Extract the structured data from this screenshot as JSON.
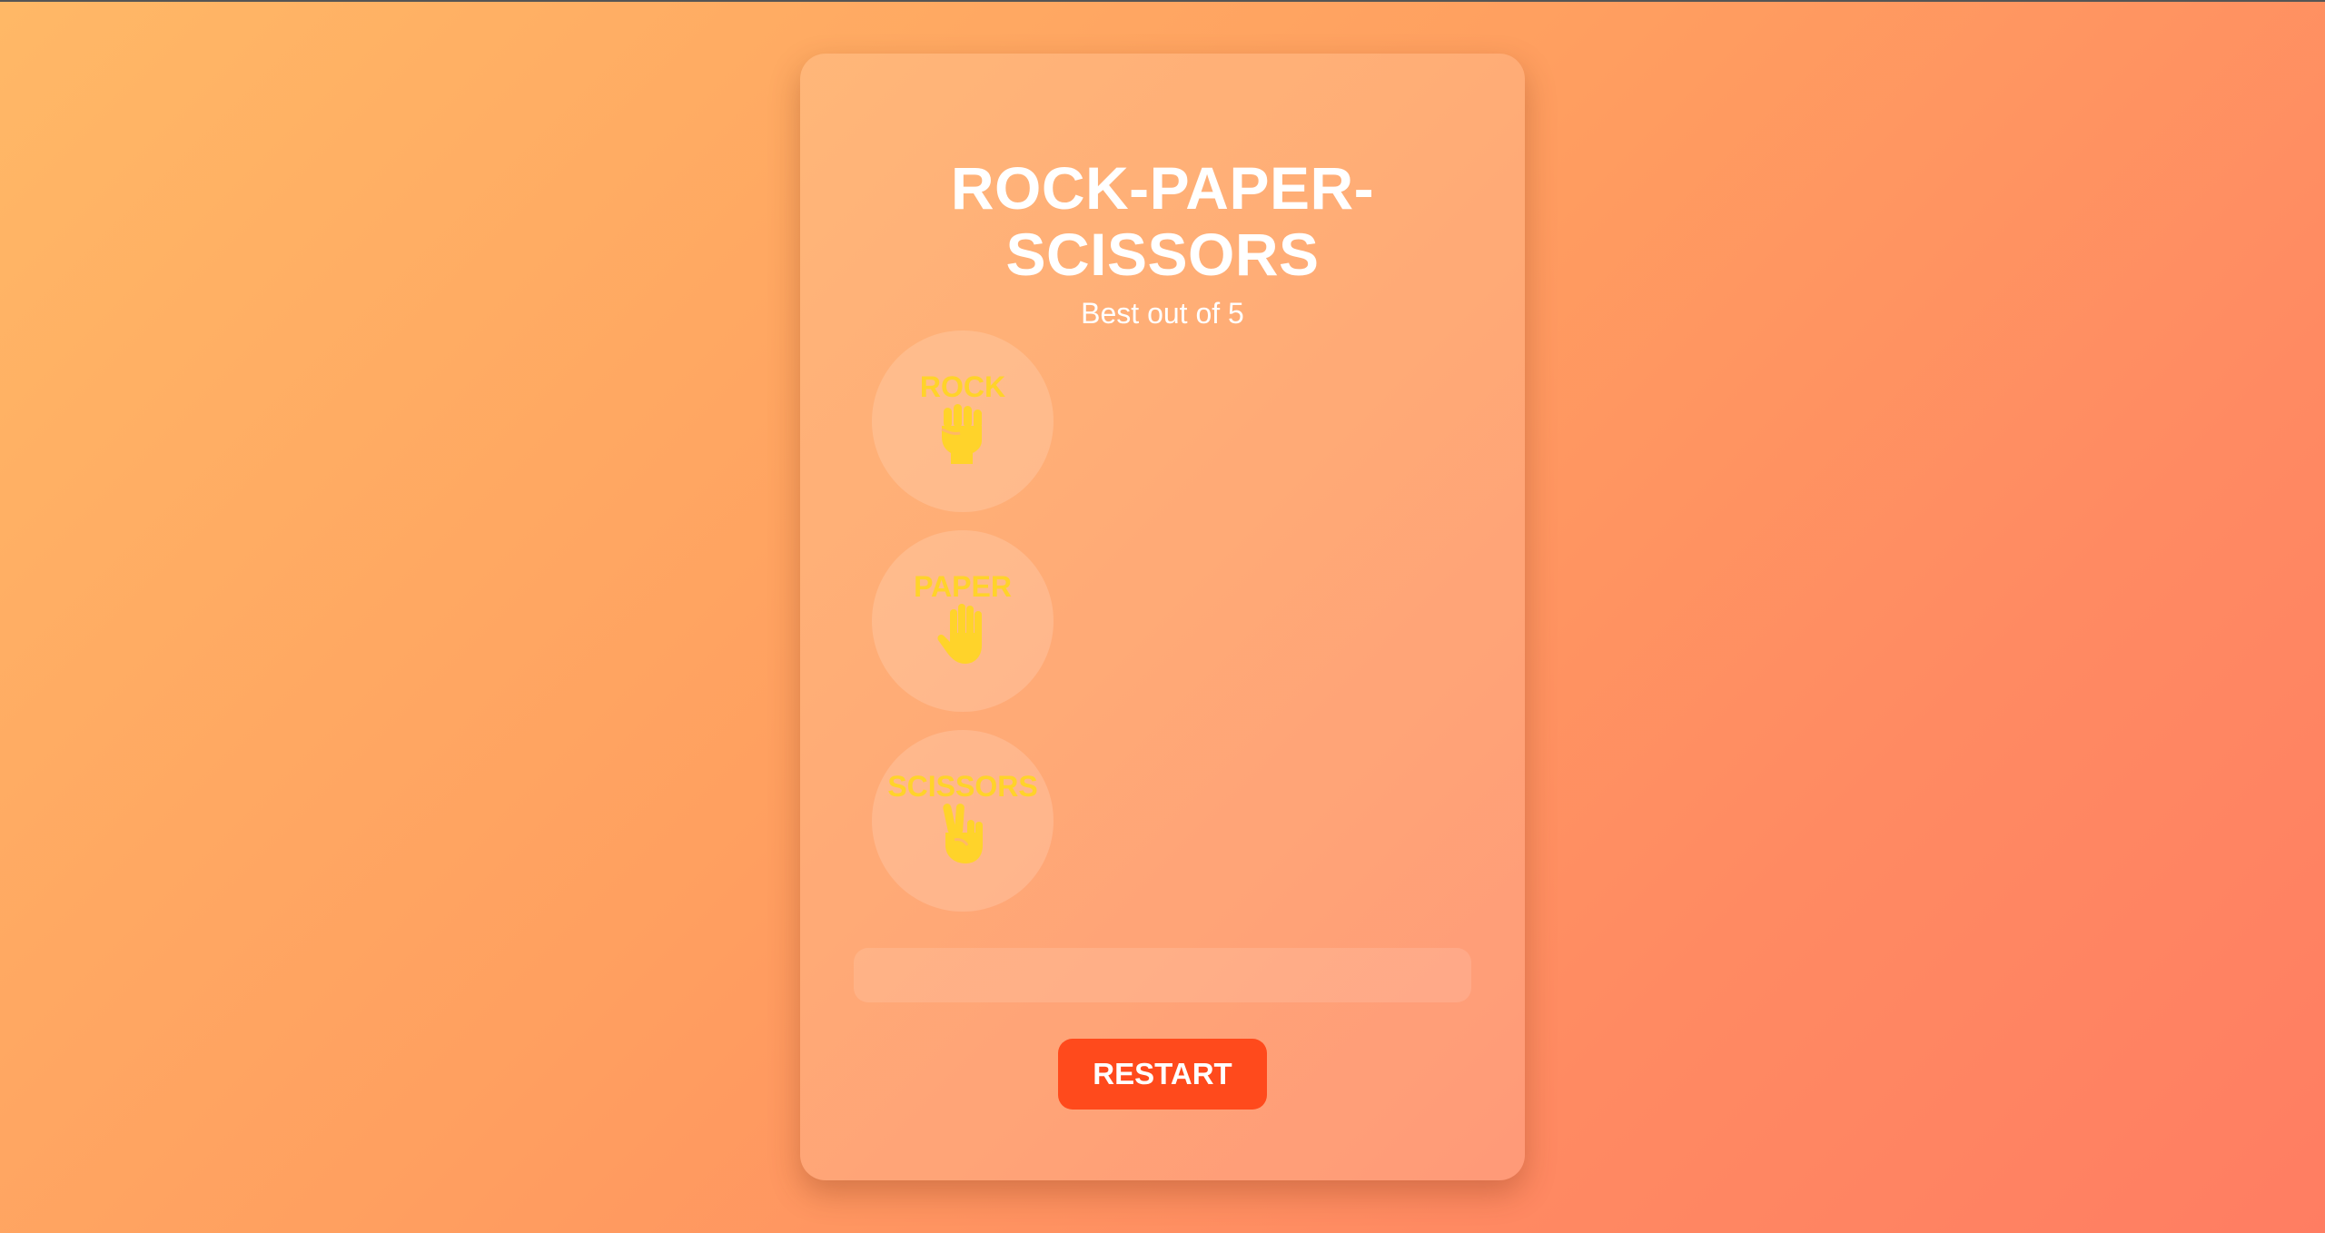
{
  "game": {
    "title_line1": "ROCK-PAPER-",
    "title_line2": "SCISSORS",
    "subtitle": "Best out of 5"
  },
  "choices": [
    {
      "label": "ROCK",
      "icon": "raised-fist-icon"
    },
    {
      "label": "PAPER",
      "icon": "raised-hand-icon"
    },
    {
      "label": "SCISSORS",
      "icon": "victory-hand-icon"
    }
  ],
  "result": {
    "text": ""
  },
  "controls": {
    "restart_label": "RESTART"
  },
  "colors": {
    "background_start": "#ffb866",
    "background_end": "#ff7d62",
    "choice_label": "#ffd32a",
    "restart_button": "#ff4a1c",
    "title": "#ffffff"
  }
}
